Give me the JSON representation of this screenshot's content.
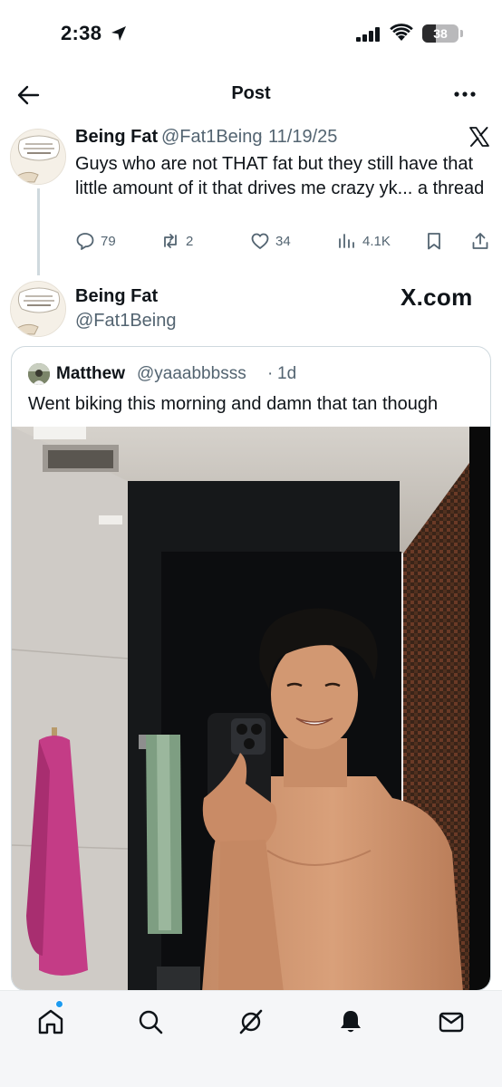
{
  "status_bar": {
    "time": "2:38",
    "battery": "38",
    "battery_level": 0.38
  },
  "header": {
    "title": "Post"
  },
  "tweet": {
    "name": "Being Fat",
    "handle": "@Fat1Being",
    "separator": "·",
    "date": "11/19/25",
    "text": "Guys who are not THAT fat but they still have that little amount of it that drives me crazy yk... a thread",
    "avatar_caption": "Screw it! Who cares if I look like a whale, I am so HUNGRY!",
    "stats": {
      "replies": "79",
      "reposts": "2",
      "likes": "34",
      "views": "4.1K"
    }
  },
  "reply": {
    "name": "Being Fat",
    "handle": "@Fat1Being",
    "watermark": "X.com",
    "quote": {
      "name": "Matthew",
      "handle": "@yaaabbbsss",
      "separator": "·",
      "time": "1d",
      "text": "Went biking this morning and damn that tan though"
    }
  },
  "colors": {
    "text_primary": "#0f1419",
    "text_secondary": "#536471",
    "accent": "#1d9bf0",
    "border": "#cfd9de"
  },
  "icons": {
    "back": "arrow-left-icon",
    "more": "more-horizontal-icon",
    "reply": "comment-icon",
    "repost": "repost-icon",
    "like": "heart-icon",
    "views": "bar-chart-icon",
    "bookmark": "bookmark-icon",
    "share": "share-icon",
    "tabs": [
      "home-icon",
      "search-icon",
      "grok-icon",
      "notifications-icon",
      "messages-icon"
    ]
  }
}
